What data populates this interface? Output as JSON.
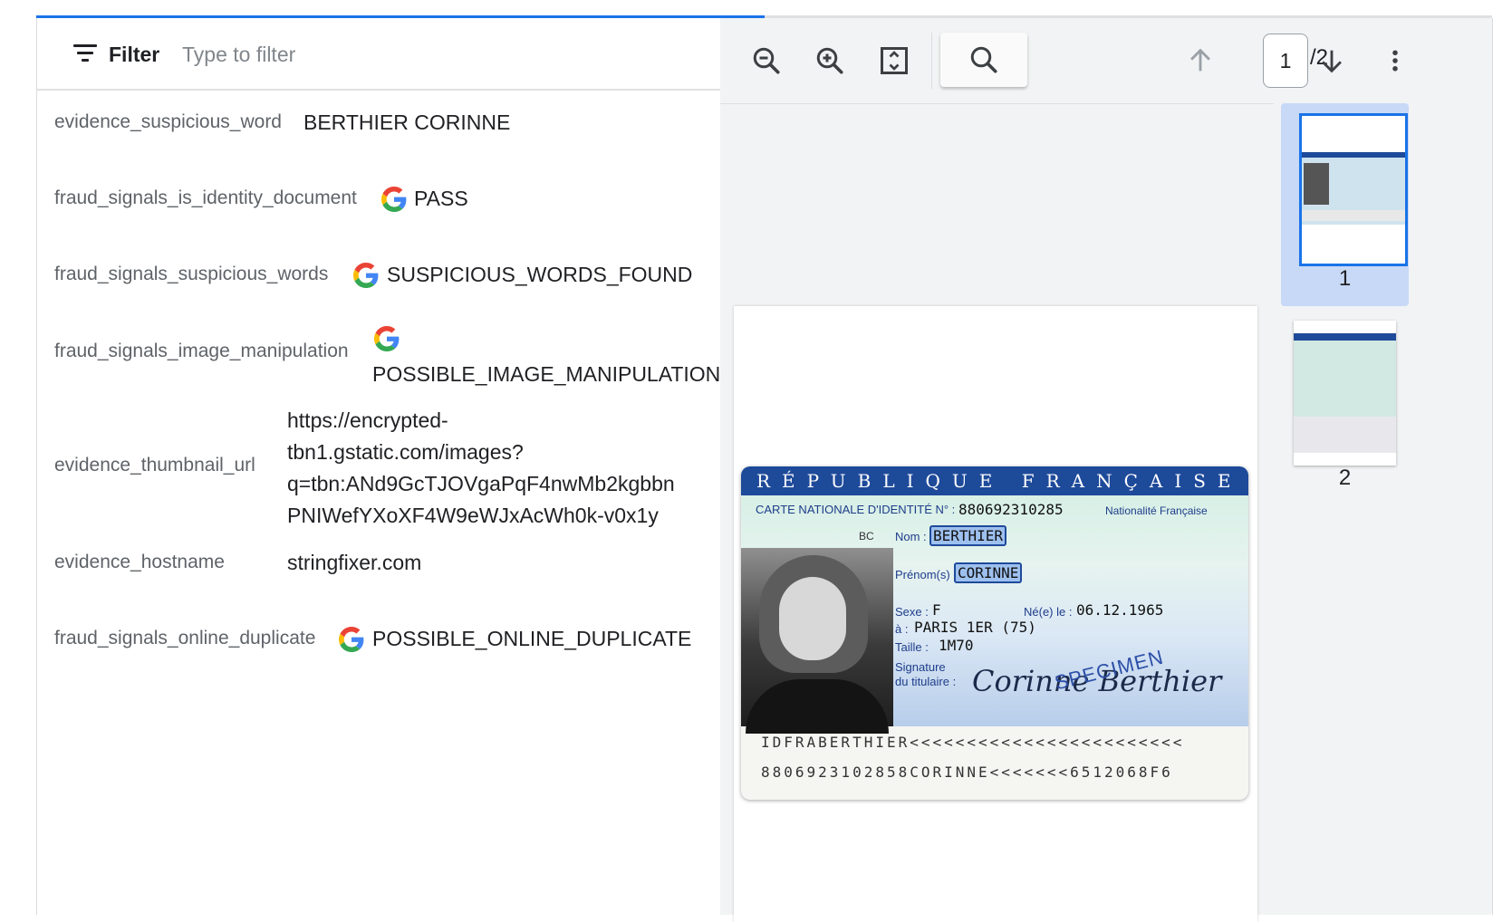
{
  "progress": {
    "value_pct": 50
  },
  "filter": {
    "label": "Filter",
    "placeholder": "Type to filter"
  },
  "properties": [
    {
      "key": "evidence_suspicious_word",
      "value": "BERTHIER CORINNE",
      "source_icon": ""
    },
    {
      "key": "fraud_signals_is_identity_document",
      "value": "PASS",
      "source_icon": "google-icon"
    },
    {
      "key": "fraud_signals_suspicious_words",
      "value": "SUSPICIOUS_WORDS_FOUND",
      "source_icon": "google-icon"
    },
    {
      "key": "fraud_signals_image_manipulation",
      "value": "POSSIBLE_IMAGE_MANIPULATION",
      "source_icon": "google-icon"
    },
    {
      "key": "evidence_thumbnail_url",
      "value_lines": [
        "https://encrypted-",
        "tbn1.gstatic.com/images?",
        "q=tbn:ANd9GcTJOVgaPqF4nwMb2kgbbn",
        "PNIWefYXoXF4W9eWJxAcWh0k-v0x1y"
      ],
      "source_icon": ""
    },
    {
      "key": "evidence_hostname",
      "value": "stringfixer.com",
      "source_icon": ""
    },
    {
      "key": "fraud_signals_online_duplicate",
      "value": "POSSIBLE_ONLINE_DUPLICATE",
      "source_icon": "google-icon"
    }
  ],
  "viewer": {
    "toolbar": {
      "zoom_out_icon": "zoom-out-icon",
      "zoom_in_icon": "zoom-in-icon",
      "fit_icon": "fit-page-icon",
      "search_icon": "search-icon",
      "prev_icon": "arrow-up-icon",
      "next_icon": "arrow-down-icon",
      "more_icon": "more-vert-icon"
    },
    "page": {
      "current": "1",
      "total": "/2"
    },
    "thumbnails": [
      {
        "label": "1",
        "selected": true
      },
      {
        "label": "2",
        "selected": false
      }
    ]
  },
  "id_card": {
    "header": "RÉPUBLIQUE FRANÇAISE",
    "card_title": "CARTE NATIONALE D'IDENTITÉ N° :",
    "card_number": "880692310285",
    "nationality": "Nationalité Française",
    "bc": "BC",
    "nom_label": "Nom :",
    "nom": "BERTHIER",
    "prenom_label": "Prénom(s) :",
    "prenom": "CORINNE",
    "sexe_label": "Sexe :",
    "sexe": "F",
    "ne_label": "Né(e) le :",
    "dob": "06.12.1965",
    "lieu_label": "à :",
    "lieu": "PARIS 1ER (75)",
    "taille_label": "Taille :",
    "taille": "1M70",
    "signature_label_1": "Signature",
    "signature_label_2": "du titulaire :",
    "signature": "Corinne Berthier",
    "specimen": "SPECIMEN",
    "mrz_1": "IDFRABERTHIER<<<<<<<<<<<<<<<<<<<<<<<<",
    "mrz_2": "8806923102858CORINNE<<<<<<<6512068F6"
  },
  "colors": {
    "accent": "#1a73e8",
    "card_blue": "#1e4a9a",
    "thumb_selected_bg": "#c7d9f7"
  }
}
